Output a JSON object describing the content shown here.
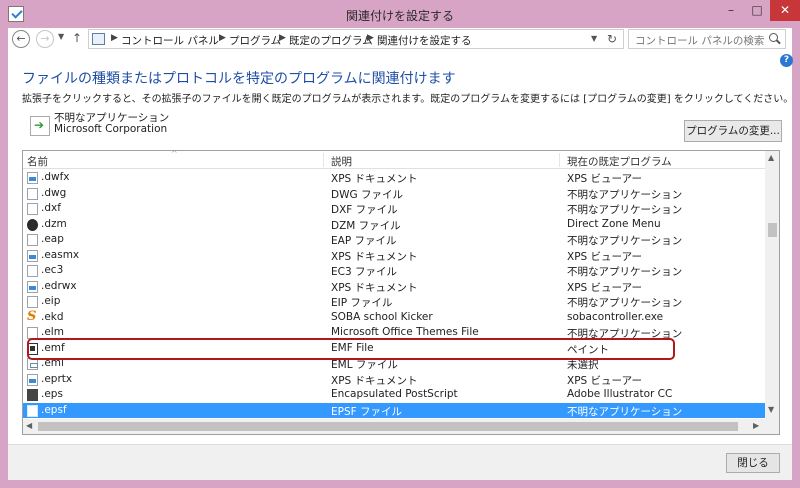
{
  "window": {
    "title": "関連付けを設定する"
  },
  "nav": {
    "back_icon": "back-arrow",
    "forward_icon": "forward-arrow",
    "up_icon": "up-arrow",
    "breadcrumbs": [
      "コントロール パネル",
      "プログラム",
      "既定のプログラム",
      "関連付けを設定する"
    ],
    "search_placeholder": "コントロール パネルの検索"
  },
  "main": {
    "heading": "ファイルの種類またはプロトコルを特定のプログラムに関連付けます",
    "description": "拡張子をクリックすると、その拡張子のファイルを開く既定のプログラムが表示されます。既定のプログラムを変更するには [プログラムの変更] をクリックしてください。",
    "current_app": {
      "name": "不明なアプリケーション",
      "company": "Microsoft Corporation"
    },
    "change_button": "プログラムの変更..."
  },
  "list": {
    "columns": [
      "名前",
      "説明",
      "現在の既定プログラム"
    ],
    "rows": [
      {
        "name": ".dwfx",
        "desc": "XPS ドキュメント",
        "prog": "XPS ビューアー",
        "icon": "xps-document-icon",
        "selected": false
      },
      {
        "name": ".dwg",
        "desc": "DWG ファイル",
        "prog": "不明なアプリケーション",
        "icon": "file-icon",
        "selected": false
      },
      {
        "name": ".dxf",
        "desc": "DXF ファイル",
        "prog": "不明なアプリケーション",
        "icon": "file-icon",
        "selected": false
      },
      {
        "name": ".dzm",
        "desc": "DZM ファイル",
        "prog": "Direct Zone Menu",
        "icon": "direct-zone-icon",
        "selected": false
      },
      {
        "name": ".eap",
        "desc": "EAP ファイル",
        "prog": "不明なアプリケーション",
        "icon": "file-icon",
        "selected": false
      },
      {
        "name": ".easmx",
        "desc": "XPS ドキュメント",
        "prog": "XPS ビューアー",
        "icon": "xps-document-icon",
        "selected": false
      },
      {
        "name": ".ec3",
        "desc": "EC3 ファイル",
        "prog": "不明なアプリケーション",
        "icon": "file-icon",
        "selected": false
      },
      {
        "name": ".edrwx",
        "desc": "XPS ドキュメント",
        "prog": "XPS ビューアー",
        "icon": "xps-document-icon",
        "selected": false
      },
      {
        "name": ".eip",
        "desc": "EIP ファイル",
        "prog": "不明なアプリケーション",
        "icon": "file-icon",
        "selected": false
      },
      {
        "name": ".ekd",
        "desc": "SOBA school Kicker",
        "prog": "sobacontroller.exe",
        "icon": "soba-icon",
        "selected": false
      },
      {
        "name": ".elm",
        "desc": "Microsoft Office Themes File",
        "prog": "不明なアプリケーション",
        "icon": "file-icon",
        "selected": false
      },
      {
        "name": ".emf",
        "desc": "EMF File",
        "prog": "ペイント",
        "icon": "emf-image-icon",
        "selected": false
      },
      {
        "name": ".eml",
        "desc": "EML ファイル",
        "prog": "未選択",
        "icon": "email-file-icon",
        "selected": false
      },
      {
        "name": ".eprtx",
        "desc": "XPS ドキュメント",
        "prog": "XPS ビューアー",
        "icon": "xps-document-icon",
        "selected": false
      },
      {
        "name": ".eps",
        "desc": "Encapsulated PostScript",
        "prog": "Adobe Illustrator CC",
        "icon": "eps-file-icon",
        "selected": false
      },
      {
        "name": ".epsf",
        "desc": "EPSF ファイル",
        "prog": "不明なアプリケーション",
        "icon": "file-icon",
        "selected": true
      }
    ]
  },
  "footer": {
    "close_button": "閉じる"
  },
  "colors": {
    "titlebar": "#d8a4c6",
    "heading": "#1f4fa5",
    "selection": "#3399ff",
    "highlight_box": "#b0191c",
    "close_button": "#c7373a"
  }
}
